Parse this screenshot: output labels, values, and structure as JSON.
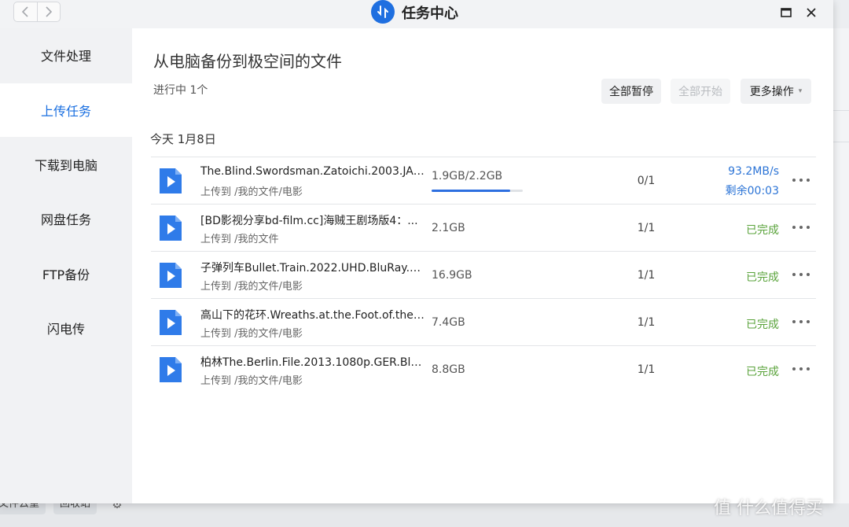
{
  "window": {
    "title": "任务中心",
    "nav_back": "‹",
    "nav_forward": "›"
  },
  "sidebar": {
    "items": [
      {
        "label": "文件处理",
        "active": false
      },
      {
        "label": "上传任务",
        "active": true
      },
      {
        "label": "下载到电脑",
        "active": false
      },
      {
        "label": "网盘任务",
        "active": false
      },
      {
        "label": "FTP备份",
        "active": false
      },
      {
        "label": "闪电传",
        "active": false
      }
    ]
  },
  "main": {
    "title": "从电脑备份到极空间的文件",
    "status": "进行中 1个",
    "buttons": {
      "pause_all": "全部暂停",
      "start_all": "全部开始",
      "more": "更多操作"
    },
    "date_group": "今天 1月8日",
    "tasks": [
      {
        "name": "The.Blind.Swordsman.Zatoichi.2003.JAP...",
        "dest": "上传到 /我的文件/电影",
        "size": "1.9GB/2.2GB",
        "progress": 0.86,
        "count": "0/1",
        "speed": "93.2MB/s",
        "remaining": "剩余00:03"
      },
      {
        "name": "[BD影视分享bd-film.cc]海贼王剧场版4：...",
        "dest": "上传到 /我的文件",
        "size": "2.1GB",
        "count": "1/1",
        "status": "已完成"
      },
      {
        "name": "子弹列车Bullet.Train.2022.UHD.BluRay.2...",
        "dest": "上传到 /我的文件/电影",
        "size": "16.9GB",
        "count": "1/1",
        "status": "已完成"
      },
      {
        "name": "高山下的花环.Wreaths.at.the.Foot.of.the....",
        "dest": "上传到 /我的文件/电影",
        "size": "7.4GB",
        "count": "1/1",
        "status": "已完成"
      },
      {
        "name": "柏林The.Berlin.File.2013.1080p.GER.BluR...",
        "dest": "上传到 /我的文件/电影",
        "size": "8.8GB",
        "count": "1/1",
        "status": "已完成"
      }
    ]
  },
  "background": {
    "chip_left": "文件云重",
    "chip_mid": "回收站"
  },
  "watermark": "值 什么值得买",
  "colors": {
    "accent": "#1a6fe0",
    "done_green": "#5aa33b",
    "speed_blue": "#2c74d6"
  }
}
